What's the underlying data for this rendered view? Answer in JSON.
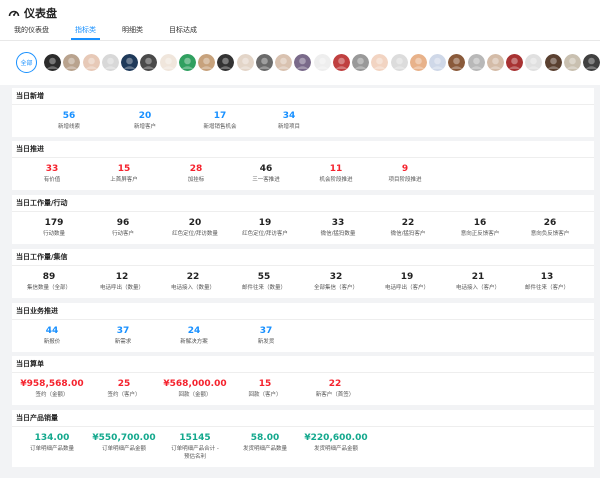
{
  "header": {
    "title": "仪表盘",
    "icon": "gauge-icon"
  },
  "tabs": [
    {
      "label": "我的仪表盘",
      "active": false
    },
    {
      "label": "指标类",
      "active": true
    },
    {
      "label": "明细类",
      "active": false
    },
    {
      "label": "目标达成",
      "active": false
    }
  ],
  "avatar_bar": {
    "all_label": "全部",
    "count": 29
  },
  "sections": [
    {
      "title": "当日新增",
      "items": [
        {
          "value": "56",
          "label": "新增线索"
        },
        {
          "value": "20",
          "label": "新增客户"
        },
        {
          "value": "17",
          "label": "新增销售机会"
        },
        {
          "value": "34",
          "label": "新增项目"
        }
      ]
    },
    {
      "title": "当日推进",
      "items": [
        {
          "value": "33",
          "label": "有价值"
        },
        {
          "value": "15",
          "label": "上首屏客户"
        },
        {
          "value": "28",
          "label": "加挂标"
        },
        {
          "value": "46",
          "label": "三一客推进"
        },
        {
          "value": "11",
          "label": "机会阶段推进"
        },
        {
          "value": "9",
          "label": "项目阶段推进"
        }
      ]
    },
    {
      "title": "当日工作量/行动",
      "items": [
        {
          "value": "179",
          "label": "行动数量"
        },
        {
          "value": "96",
          "label": "行动客户"
        },
        {
          "value": "20",
          "label": "红色定位/拜访数量"
        },
        {
          "value": "19",
          "label": "红色定位/拜访客户"
        },
        {
          "value": "33",
          "label": "微信/猛犸数量"
        },
        {
          "value": "22",
          "label": "微信/猛犸客户"
        },
        {
          "value": "16",
          "label": "意向正反馈客户"
        },
        {
          "value": "26",
          "label": "意向负反馈客户"
        }
      ]
    },
    {
      "title": "当日工作量/集信",
      "items": [
        {
          "value": "89",
          "label": "集信数量（全部）"
        },
        {
          "value": "12",
          "label": "电话呼出（数量）"
        },
        {
          "value": "22",
          "label": "电话接入（数量）"
        },
        {
          "value": "55",
          "label": "邮件往来（数量）"
        },
        {
          "value": "32",
          "label": "全部集信（客户）"
        },
        {
          "value": "19",
          "label": "电话呼出（客户）"
        },
        {
          "value": "21",
          "label": "电话接入（客户）"
        },
        {
          "value": "13",
          "label": "邮件往来（客户）"
        }
      ]
    },
    {
      "title": "当日业务推进",
      "items": [
        {
          "value": "44",
          "label": "新报价"
        },
        {
          "value": "37",
          "label": "新需求"
        },
        {
          "value": "24",
          "label": "新解决方案"
        },
        {
          "value": "37",
          "label": "新发货"
        }
      ]
    },
    {
      "title": "当日算单",
      "items": [
        {
          "value": "¥958,568.00",
          "label": "签约（金额）"
        },
        {
          "value": "25",
          "label": "签约（客户）"
        },
        {
          "value": "¥568,000.00",
          "label": "回款（金额）"
        },
        {
          "value": "15",
          "label": "回款（客户）"
        },
        {
          "value": "22",
          "label": "新客户（首签）"
        }
      ]
    },
    {
      "title": "当日产品销量",
      "items": [
        {
          "value": "134.00",
          "label": "订单明细产品数量"
        },
        {
          "value": "¥550,700.00",
          "label": "订单明细产品金额"
        },
        {
          "value": "15145",
          "label": "订单明细产品合计 - 预估名利"
        },
        {
          "value": "58.00",
          "label": "发货明细产品数量"
        },
        {
          "value": "¥220,600.00",
          "label": "发货明细产品金额"
        }
      ]
    }
  ],
  "colors": {
    "accent": "#1890ff",
    "positive": "#f5222d",
    "neutral": "#222222",
    "product": "#13a88d"
  }
}
